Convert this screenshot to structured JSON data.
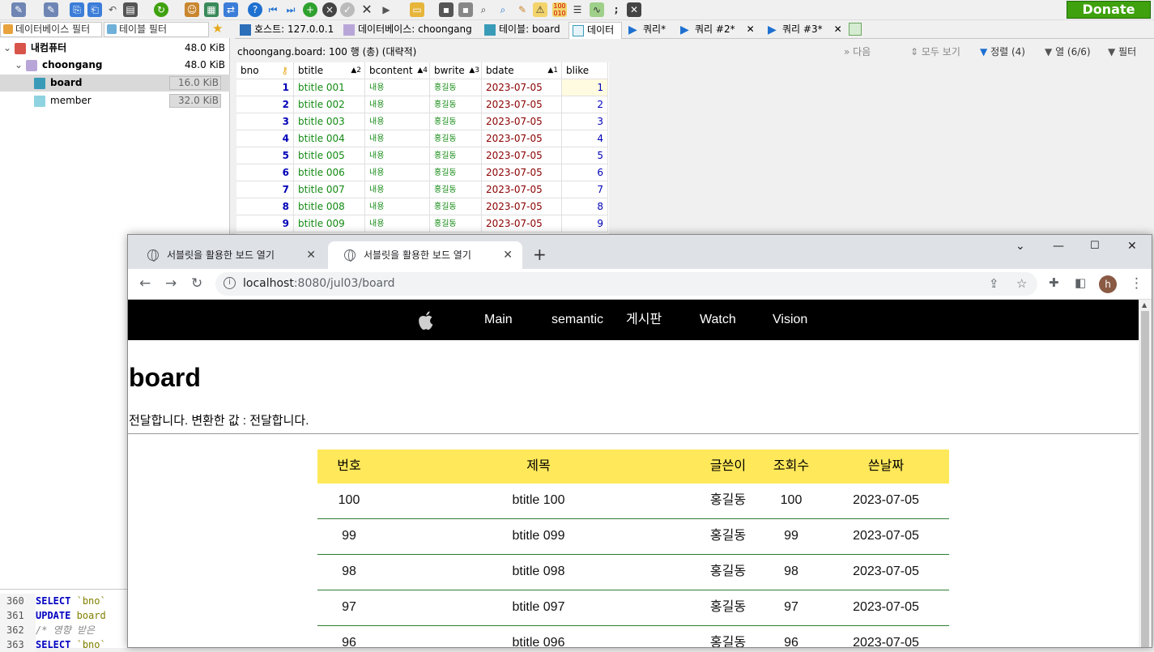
{
  "heidi": {
    "donate_label": "Donate",
    "filters": {
      "db_placeholder": "데이터베이스 필터",
      "table_placeholder": "테이블 필터"
    },
    "tree": [
      {
        "name": "내컴퓨터",
        "size": "48.0 KiB",
        "level": 0,
        "bold": true
      },
      {
        "name": "choongang",
        "size": "48.0 KiB",
        "level": 1,
        "bold": true
      },
      {
        "name": "board",
        "size": "16.0 KiB",
        "level": 2,
        "bold": true,
        "selected": true
      },
      {
        "name": "member",
        "size": "32.0 KiB",
        "level": 2,
        "bold": false
      }
    ],
    "tabs": [
      {
        "label": "호스트: 127.0.0.1"
      },
      {
        "label": "데이터베이스: choongang"
      },
      {
        "label": "테이블: board"
      },
      {
        "label": "데이터"
      },
      {
        "label": "쿼리*"
      },
      {
        "label": "쿼리 #2*"
      },
      {
        "label": "쿼리 #3*"
      }
    ],
    "grid_info": "choongang.board: 100 행 (총) (대략적)",
    "grid_controls": {
      "next": "다음",
      "show_all": "모두 보기",
      "sort": "정렬 (4)",
      "columns": "열 (6/6)",
      "filter": "필터"
    },
    "grid_headers": [
      "bno",
      "btitle",
      "bcontent",
      "bwrite",
      "bdate",
      "blike"
    ],
    "grid_sort_marks": [
      "",
      "▲2",
      "▲4",
      "▲3",
      "▲1",
      ""
    ],
    "grid_rows": [
      [
        "1",
        "btitle 001",
        "내용",
        "홍길동",
        "2023-07-05",
        "1"
      ],
      [
        "2",
        "btitle 002",
        "내용",
        "홍길동",
        "2023-07-05",
        "2"
      ],
      [
        "3",
        "btitle 003",
        "내용",
        "홍길동",
        "2023-07-05",
        "3"
      ],
      [
        "4",
        "btitle 004",
        "내용",
        "홍길동",
        "2023-07-05",
        "4"
      ],
      [
        "5",
        "btitle 005",
        "내용",
        "홍길동",
        "2023-07-05",
        "5"
      ],
      [
        "6",
        "btitle 006",
        "내용",
        "홍길동",
        "2023-07-05",
        "6"
      ],
      [
        "7",
        "btitle 007",
        "내용",
        "홍길동",
        "2023-07-05",
        "7"
      ],
      [
        "8",
        "btitle 008",
        "내용",
        "홍길동",
        "2023-07-05",
        "8"
      ],
      [
        "9",
        "btitle 009",
        "내용",
        "홍길동",
        "2023-07-05",
        "9"
      ]
    ],
    "sql_log": [
      {
        "line": "360",
        "kw": "SELECT",
        "rest": "`bno`"
      },
      {
        "line": "361",
        "kw": "UPDATE",
        "rest": "board"
      },
      {
        "line": "362",
        "kw": "",
        "rest": "/* 영향 받은"
      },
      {
        "line": "363",
        "kw": "SELECT",
        "rest": "`bno`"
      }
    ]
  },
  "browser": {
    "tabs": [
      {
        "title": "서블릿을 활용한 보드 열기",
        "active": false
      },
      {
        "title": "서블릿을 활용한 보드 열기",
        "active": true
      }
    ],
    "url_host": "localhost",
    "url_path": ":8080/jul03/board",
    "avatar_letter": "h"
  },
  "page": {
    "nav": [
      "Main",
      "semantic",
      "게시판",
      "Watch",
      "Vision"
    ],
    "title": "board",
    "message": "전달합니다. 변환한 값 : 전달합니다.",
    "table_headers": [
      "번호",
      "제목",
      "글쓴이",
      "조회수",
      "쓴날짜"
    ],
    "table_rows": [
      [
        "100",
        "btitle 100",
        "홍길동",
        "100",
        "2023-07-05"
      ],
      [
        "99",
        "btitle 099",
        "홍길동",
        "99",
        "2023-07-05"
      ],
      [
        "98",
        "btitle 098",
        "홍길동",
        "98",
        "2023-07-05"
      ],
      [
        "97",
        "btitle 097",
        "홍길동",
        "97",
        "2023-07-05"
      ],
      [
        "96",
        "btitle 096",
        "홍길동",
        "96",
        "2023-07-05"
      ]
    ]
  },
  "colors": {
    "table_header_bg": "#ffe85a",
    "row_border": "#2e7d32",
    "site_nav_bg": "#000000",
    "donate_bg": "#3fa10e"
  }
}
